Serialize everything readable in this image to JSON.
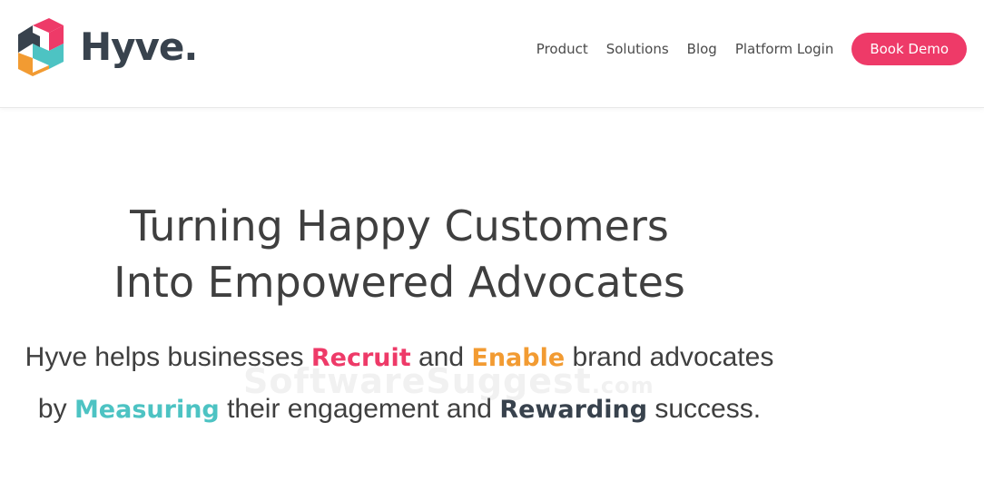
{
  "brand": {
    "name": "Hyve.",
    "colors": {
      "pink": "#ee3a68",
      "orange": "#f29b32",
      "teal": "#4dc3c3",
      "dark": "#38424d"
    }
  },
  "nav": {
    "items": [
      {
        "label": "Product"
      },
      {
        "label": "Solutions"
      },
      {
        "label": "Blog"
      },
      {
        "label": "Platform Login"
      }
    ],
    "cta_label": "Book Demo"
  },
  "hero": {
    "title_line1": "Turning Happy Customers",
    "title_line2": "Into Empowered Advocates",
    "sub": {
      "part1": "Hyve helps businesses ",
      "recruit": "Recruit",
      "part2": " and ",
      "enable": "Enable",
      "part3": " brand advocates",
      "part4": "by ",
      "measuring": "Measuring",
      "part5": " their engagement and ",
      "rewarding": "Rewarding",
      "part6": " success."
    }
  },
  "watermark": {
    "text": "SoftwareSuggest",
    "suffix": ".com"
  }
}
